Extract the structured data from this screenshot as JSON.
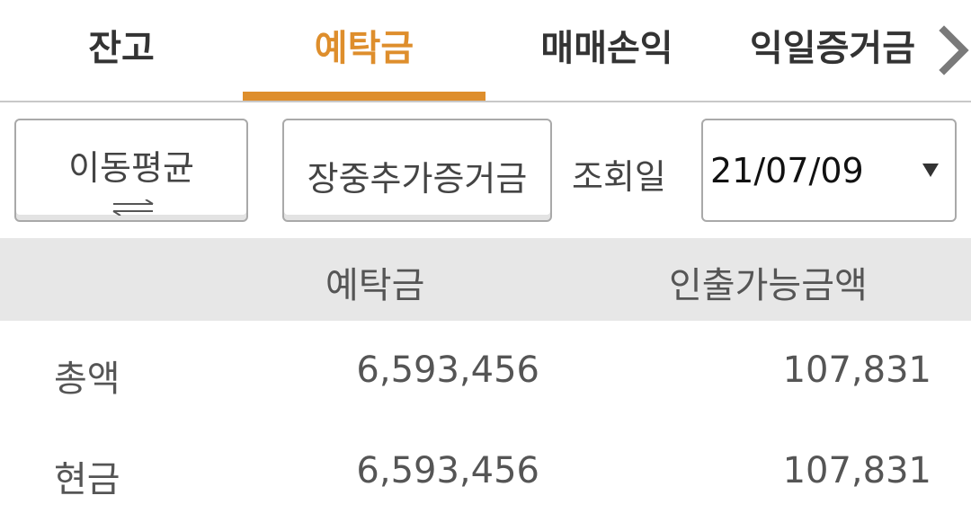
{
  "tabs": [
    {
      "label": "잔고",
      "active": false
    },
    {
      "label": "예탁금",
      "active": true
    },
    {
      "label": "매매손익",
      "active": false
    },
    {
      "label": "익일증거금",
      "active": false
    }
  ],
  "colors": {
    "accent": "#de8e2c",
    "header_bg": "#e7e7e7"
  },
  "icons": {
    "tab_scroll": "chevron-right-icon",
    "toggle": "swap-arrows-icon",
    "select": "caret-down-icon"
  },
  "controls": {
    "avg_button_label": "이동평균",
    "margin_button_label": "장중추가증거금",
    "date_label": "조회일",
    "date_value": "21/07/09"
  },
  "table": {
    "headers": [
      "",
      "예탁금",
      "인출가능금액"
    ],
    "rows": [
      {
        "label": "총액",
        "deposit": "6,593,456",
        "withdrawable": "107,831"
      },
      {
        "label": "현금",
        "deposit": "6,593,456",
        "withdrawable": "107,831"
      }
    ]
  }
}
